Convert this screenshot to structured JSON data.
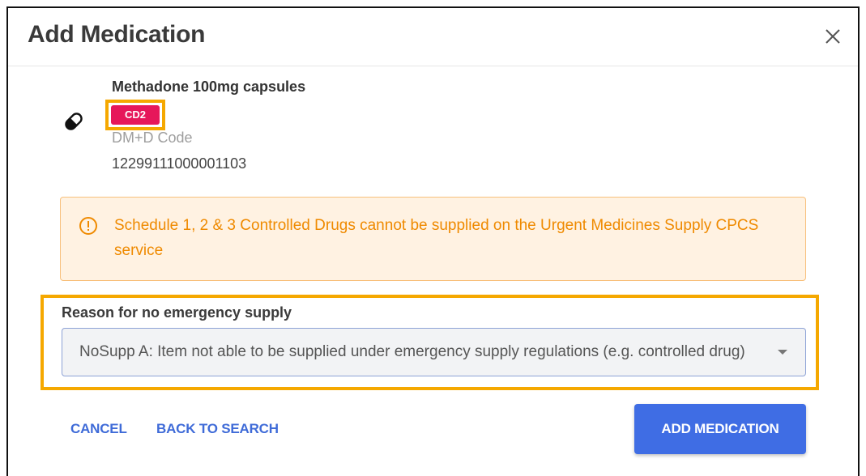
{
  "dialog": {
    "title": "Add Medication",
    "close_icon": "close-icon"
  },
  "medication": {
    "icon": "pill-icon",
    "name": "Methadone 100mg capsules",
    "badge": "CD2",
    "dmd_label": "DM+D Code",
    "dmd_value": "12299111000001103"
  },
  "warning": {
    "icon": "warning-circle-icon",
    "text": "Schedule 1, 2 & 3 Controlled Drugs cannot be supplied on the Urgent Medicines Supply CPCS service"
  },
  "reason": {
    "label": "Reason for no emergency supply",
    "selected": "NoSupp A: Item not able to be supplied under emergency supply regulations (e.g. controlled drug)",
    "caret_icon": "caret-down-icon"
  },
  "actions": {
    "cancel_label": "CANCEL",
    "back_label": "BACK TO SEARCH",
    "add_label": "ADD MEDICATION"
  },
  "colors": {
    "badge": "#e6175a",
    "highlight": "#f5a800",
    "warning_text": "#ef8a00",
    "warning_bg": "#fff2e2",
    "primary": "#3f6de4"
  }
}
